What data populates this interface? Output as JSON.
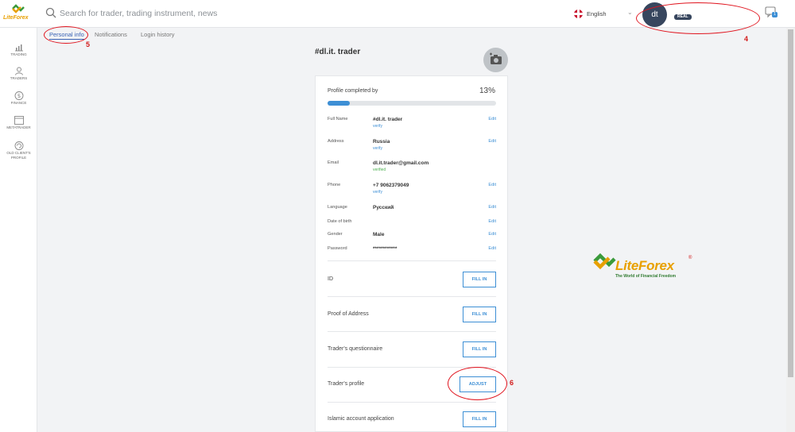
{
  "logo": {
    "text": "LiteForex"
  },
  "search": {
    "placeholder": "Search for trader, trading instrument, news"
  },
  "language": {
    "label": "English"
  },
  "user": {
    "initials": "dt",
    "account_badge": "REAL"
  },
  "notifications": {
    "count": "1"
  },
  "sidebar": {
    "items": [
      {
        "label": "TRADING",
        "icon": "chart-icon"
      },
      {
        "label": "TRADERS",
        "icon": "traders-icon"
      },
      {
        "label": "FINANCE",
        "icon": "dollar-icon"
      },
      {
        "label": "METATRADER",
        "icon": "window-icon"
      },
      {
        "label": "OLD CLIENT'S PROFILE",
        "icon": "refresh-icon"
      }
    ]
  },
  "tabs": [
    {
      "label": "Personal info",
      "active": true
    },
    {
      "label": "Notifications",
      "active": false
    },
    {
      "label": "Login history",
      "active": false
    }
  ],
  "profile": {
    "name": "#dl.it. trader",
    "completed_label": "Profile completed by",
    "completed_percent": "13%",
    "completed_fraction": 0.13,
    "fields": [
      {
        "key": "Full Name",
        "value": "#dl.it. trader",
        "status": "verify",
        "action": "Edit"
      },
      {
        "key": "Address",
        "value": "Russia",
        "status": "verify",
        "action": "Edit"
      },
      {
        "key": "Email",
        "value": "dl.it.trader@gmail.com",
        "status": "verified",
        "action": ""
      },
      {
        "key": "Phone",
        "value": "+7 9062379049",
        "status": "verify",
        "action": "Edit"
      },
      {
        "key": "Language",
        "value": "Русский",
        "status": "",
        "action": "Edit"
      },
      {
        "key": "Date of birth",
        "value": "",
        "status": "",
        "action": "Edit"
      },
      {
        "key": "Gender",
        "value": "Male",
        "status": "",
        "action": "Edit"
      },
      {
        "key": "Password",
        "value": "************",
        "status": "",
        "action": "Edit"
      }
    ],
    "documents": [
      {
        "label": "ID",
        "button": "FILL IN"
      },
      {
        "label": "Proof of Address",
        "button": "FILL IN"
      },
      {
        "label": "Trader's questionnaire",
        "button": "FILL IN"
      },
      {
        "label": "Trader's profile",
        "button": "ADJUST"
      },
      {
        "label": "Islamic account application",
        "button": "FILL IN"
      }
    ]
  },
  "watermark": {
    "brand": "LiteForex",
    "registered": "®",
    "tagline": "The World of Financial Freedom"
  },
  "annotations": {
    "avatar_marker": "4",
    "tab_marker": "5",
    "adjust_marker": "6"
  },
  "colors": {
    "accent": "#3d8fd5",
    "brand": "#e8a000",
    "annotation": "#e0141e",
    "avatar": "#37465e"
  }
}
